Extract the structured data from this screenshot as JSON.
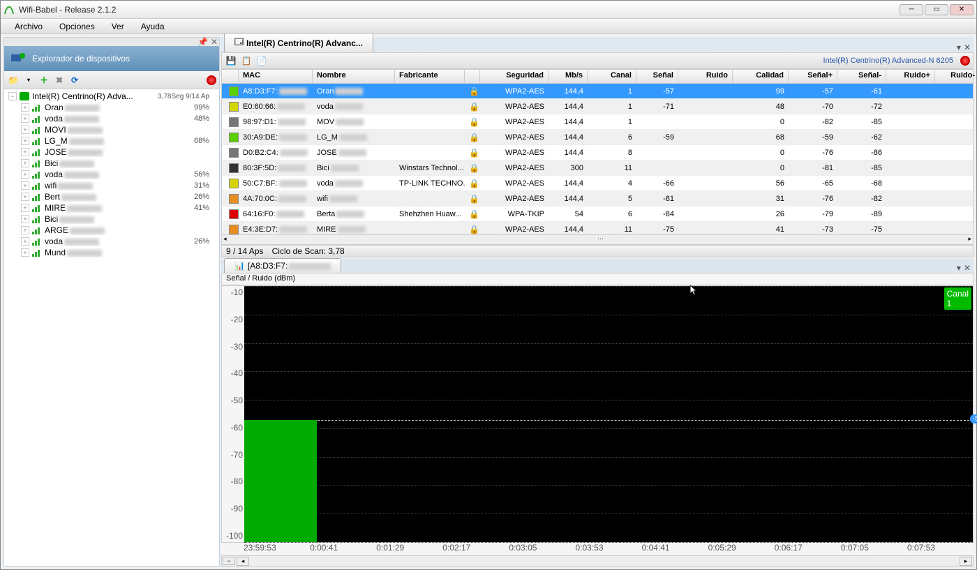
{
  "window": {
    "title": "Wifi-Babel - Release 2.1.2"
  },
  "menu": {
    "archivo": "Archivo",
    "opciones": "Opciones",
    "ver": "Ver",
    "ayuda": "Ayuda"
  },
  "sidebar": {
    "title": "Explorador de dispositivos",
    "root": "Intel(R) Centrino(R) Adva...",
    "root_meta": "3,78Seg 9/14 Ap",
    "items": [
      {
        "name": "Oran",
        "pct": "99%"
      },
      {
        "name": "voda",
        "pct": "48%"
      },
      {
        "name": "MOVI",
        "pct": ""
      },
      {
        "name": "LG_M",
        "pct": "68%"
      },
      {
        "name": "JOSE",
        "pct": ""
      },
      {
        "name": "Bici",
        "pct": ""
      },
      {
        "name": "voda",
        "pct": "56%"
      },
      {
        "name": "wifi",
        "pct": "31%"
      },
      {
        "name": "Bert",
        "pct": "26%"
      },
      {
        "name": "MIRE",
        "pct": "41%"
      },
      {
        "name": "Bici",
        "pct": ""
      },
      {
        "name": "ARGE",
        "pct": ""
      },
      {
        "name": "voda",
        "pct": "26%"
      },
      {
        "name": "Mund",
        "pct": ""
      }
    ]
  },
  "main_tab": {
    "label": "Intel(R) Centrino(R) Advanc...",
    "adapter": "Intel(R) Centrino(R) Advanced-N 6205"
  },
  "columns": {
    "mac": "MAC",
    "nombre": "Nombre",
    "fab": "Fabricante",
    "seg": "Seguridad",
    "mbs": "Mb/s",
    "canal": "Canal",
    "senal": "Señal",
    "ruido": "Ruido",
    "calidad": "Calidad",
    "senalp": "Señal+",
    "senalm": "Señal-",
    "ruidop": "Ruido+",
    "ruidom": "Ruido-"
  },
  "rows": [
    {
      "c": "#5bd000",
      "mac": "A8:D3:F7:",
      "nom": "Oran",
      "fab": "",
      "seg": "WPA2-AES",
      "mbs": "144,4",
      "can": "1",
      "sen": "-57",
      "rui": "",
      "cal": "99",
      "sp": "-57",
      "sm": "-61",
      "rp": "",
      "rm": "",
      "sel": true
    },
    {
      "c": "#d4d400",
      "mac": "E0:60:66:",
      "nom": "voda",
      "fab": "",
      "seg": "WPA2-AES",
      "mbs": "144,4",
      "can": "1",
      "sen": "-71",
      "rui": "",
      "cal": "48",
      "sp": "-70",
      "sm": "-72",
      "rp": "",
      "rm": ""
    },
    {
      "c": "#777",
      "mac": "98:97:D1:",
      "nom": "MOV",
      "fab": "",
      "seg": "WPA2-AES",
      "mbs": "144,4",
      "can": "1",
      "sen": "",
      "rui": "",
      "cal": "0",
      "sp": "-82",
      "sm": "-85",
      "rp": "",
      "rm": ""
    },
    {
      "c": "#5bd000",
      "mac": "30:A9:DE:",
      "nom": "LG_M",
      "fab": "",
      "seg": "WPA2-AES",
      "mbs": "144,4",
      "can": "6",
      "sen": "-59",
      "rui": "",
      "cal": "68",
      "sp": "-59",
      "sm": "-62",
      "rp": "",
      "rm": ""
    },
    {
      "c": "#777",
      "mac": "D0:B2:C4:",
      "nom": "JOSE",
      "fab": "",
      "seg": "WPA2-AES",
      "mbs": "144,4",
      "can": "8",
      "sen": "",
      "rui": "",
      "cal": "0",
      "sp": "-76",
      "sm": "-86",
      "rp": "",
      "rm": ""
    },
    {
      "c": "#333",
      "mac": "80:3F:5D:",
      "nom": "Bici",
      "fab": "Winstars Technol...",
      "seg": "WPA2-AES",
      "mbs": "300",
      "can": "11",
      "sen": "",
      "rui": "",
      "cal": "0",
      "sp": "-81",
      "sm": "-85",
      "rp": "",
      "rm": ""
    },
    {
      "c": "#d4d400",
      "mac": "50:C7:BF:",
      "nom": "voda",
      "fab": "TP-LINK TECHNO...",
      "seg": "WPA2-AES",
      "mbs": "144,4",
      "can": "4",
      "sen": "-66",
      "rui": "",
      "cal": "56",
      "sp": "-65",
      "sm": "-68",
      "rp": "",
      "rm": ""
    },
    {
      "c": "#e88e20",
      "mac": "4A:70:0C:",
      "nom": "wifi",
      "fab": "",
      "seg": "WPA2-AES",
      "mbs": "144,4",
      "can": "5",
      "sen": "-81",
      "rui": "",
      "cal": "31",
      "sp": "-76",
      "sm": "-82",
      "rp": "",
      "rm": ""
    },
    {
      "c": "#d00",
      "mac": "64:16:F0:",
      "nom": "Berta",
      "fab": "Shehzhen Huaw...",
      "seg": "WPA-TKIP",
      "mbs": "54",
      "can": "6",
      "sen": "-84",
      "rui": "",
      "cal": "26",
      "sp": "-79",
      "sm": "-89",
      "rp": "",
      "rm": ""
    },
    {
      "c": "#e88e20",
      "mac": "E4:3E:D7:",
      "nom": "MIRE",
      "fab": "",
      "seg": "WPA2-AES",
      "mbs": "144,4",
      "can": "11",
      "sen": "-75",
      "rui": "",
      "cal": "41",
      "sp": "-73",
      "sm": "-75",
      "rp": "",
      "rm": ""
    }
  ],
  "status": {
    "aps": "9 / 14 Aps",
    "scan": "Ciclo de Scan: 3,78"
  },
  "chart": {
    "tab": "[A8:D3:F7:",
    "title": "Señal / Ruido (dBm)",
    "canal": "Canal",
    "canal_n": "1",
    "current": "-57"
  },
  "chart_data": {
    "type": "line",
    "ylabel": "Señal / Ruido (dBm)",
    "ylim": [
      -100,
      -10
    ],
    "yticks": [
      -10,
      -20,
      -30,
      -40,
      -50,
      -60,
      -70,
      -80,
      -90,
      -100
    ],
    "x": [
      "23:59:53",
      "0:00:41",
      "0:01:29",
      "0:02:17",
      "0:03:05",
      "0:03:53",
      "0:04:41",
      "0:05:29",
      "0:06:17",
      "0:07:05",
      "0:07:53"
    ],
    "series": [
      {
        "name": "Señal",
        "values": [
          -57
        ],
        "color": "#00aa00",
        "fill": true
      }
    ],
    "current_marker": -57
  }
}
